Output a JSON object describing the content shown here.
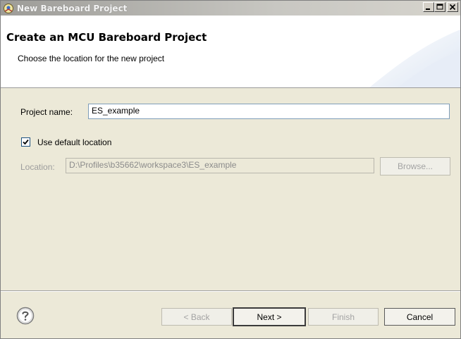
{
  "window": {
    "title": "New Bareboard Project",
    "controls": {
      "minimize_icon": "minimize-icon",
      "maximize_icon": "maximize-icon",
      "close_icon": "close-icon"
    }
  },
  "header": {
    "title": "Create an MCU Bareboard Project",
    "description": "Choose the location for the new project"
  },
  "form": {
    "project_name_label": "Project name:",
    "project_name_value": "ES_example",
    "use_default_location_label": "Use default location",
    "use_default_location_checked": true,
    "location_label": "Location:",
    "location_value": "D:\\Profiles\\b35662\\workspace3\\ES_example",
    "browse_label": "Browse..."
  },
  "footer": {
    "help_icon": "help-icon",
    "back_label": "< Back",
    "next_label": "Next >",
    "finish_label": "Finish",
    "cancel_label": "Cancel"
  },
  "colors": {
    "dialog_bg": "#ece9d8",
    "header_bg": "#ffffff",
    "field_border": "#7f9db9",
    "disabled_text": "#8b8b8b"
  }
}
